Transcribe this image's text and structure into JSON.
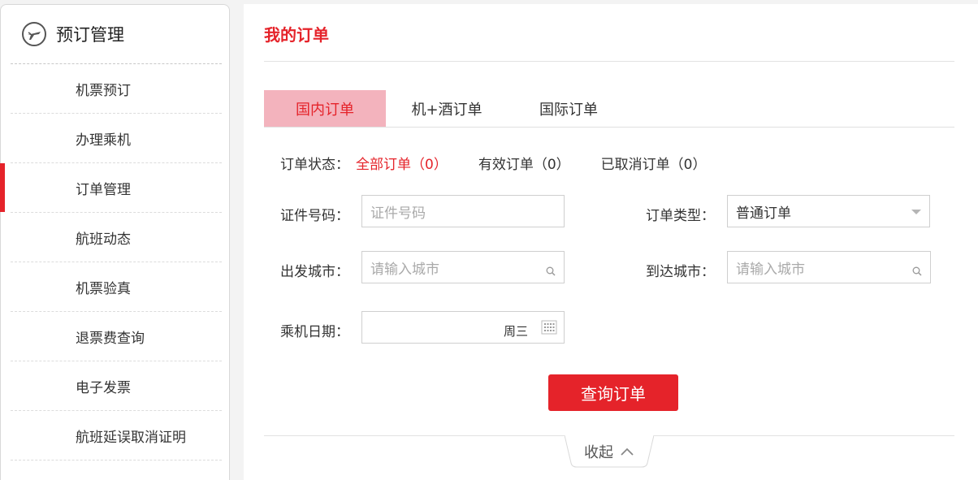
{
  "sidebar": {
    "title": "预订管理",
    "items": [
      {
        "label": "机票预订"
      },
      {
        "label": "办理乘机"
      },
      {
        "label": "订单管理"
      },
      {
        "label": "航班动态"
      },
      {
        "label": "机票验真"
      },
      {
        "label": "退票费查询"
      },
      {
        "label": "电子发票"
      },
      {
        "label": "航班延误取消证明"
      }
    ],
    "active_index": 2
  },
  "main": {
    "title": "我的订单",
    "tabs": [
      {
        "label": "国内订单",
        "active": true
      },
      {
        "label": "机+酒订单",
        "active": false
      },
      {
        "label": "国际订单",
        "active": false
      }
    ],
    "status": {
      "label": "订单状态：",
      "all": "全部订单（0）",
      "valid": "有效订单（0）",
      "cancelled": "已取消订单（0）"
    },
    "form": {
      "id_label": "证件号码：",
      "id_placeholder": "证件号码",
      "type_label": "订单类型：",
      "type_value": "普通订单",
      "depart_label": "出发城市：",
      "depart_placeholder": "请输入城市",
      "arrive_label": "到达城市：",
      "arrive_placeholder": "请输入城市",
      "date_label": "乘机日期：",
      "date_weekday": "周三"
    },
    "query_button": "查询订单",
    "collapse_label": "收起"
  },
  "colors": {
    "accent": "#e5232a",
    "tab_active_bg": "#f3b3bd"
  }
}
